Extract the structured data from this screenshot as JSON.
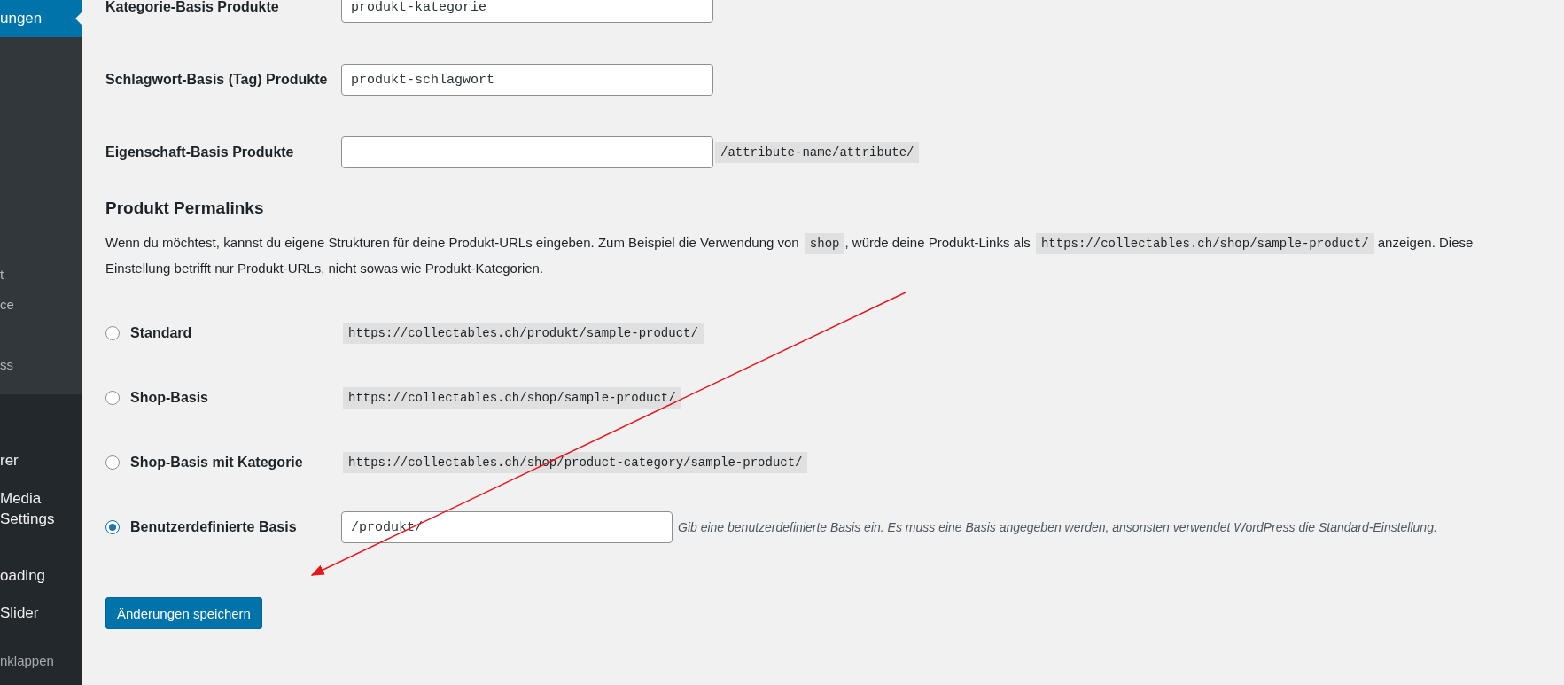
{
  "sidebar": {
    "items": [
      {
        "label": "ungen",
        "kind": "menu",
        "selected": true
      },
      {
        "label": "t",
        "kind": "submenu",
        "selected": false
      },
      {
        "label": "ce",
        "kind": "submenu",
        "selected": false
      },
      {
        "label": "ss",
        "kind": "submenu",
        "selected": false
      },
      {
        "label": "rer",
        "kind": "menu",
        "selected": false
      },
      {
        "label": "Media Settings",
        "kind": "menu",
        "selected": false
      },
      {
        "label": "oading",
        "kind": "menu",
        "selected": false
      },
      {
        "label": "Slider",
        "kind": "menu",
        "selected": false
      },
      {
        "label": "nklappen",
        "kind": "collapse",
        "selected": false
      }
    ]
  },
  "fields": [
    {
      "label": "Kategorie-Basis Produkte",
      "value": "produkt-kategorie"
    },
    {
      "label": "Schlagwort-Basis (Tag) Produkte",
      "value": "produkt-schlagwort"
    },
    {
      "label": "Eigenschaft-Basis Produkte",
      "example": "/attribute-name/attribute/"
    }
  ],
  "section_title": "Produkt Permalinks",
  "description": [
    {
      "kind": "text",
      "text": "Wenn du möchtest, kannst du eigene Strukturen für deine Produkt-URLs eingeben. Zum Beispiel die Verwendung von "
    },
    {
      "kind": "code",
      "text": "shop"
    },
    {
      "kind": "text",
      "text": ", würde deine Produkt-Links als "
    },
    {
      "kind": "code",
      "text": "https://collectables.ch/shop/sample-product/"
    },
    {
      "kind": "text",
      "text": " anzeigen. Diese Einstellung betrifft nur Produkt-URLs, nicht sowas wie Produkt-Kategorien."
    }
  ],
  "options": [
    {
      "label": "Standard",
      "kind": "example",
      "selected": false,
      "example": "https://collectables.ch/produkt/sample-product/"
    },
    {
      "label": "Shop-Basis",
      "kind": "example",
      "selected": false,
      "example": "https://collectables.ch/shop/sample-product/"
    },
    {
      "label": "Shop-Basis mit Kategorie",
      "kind": "example",
      "selected": false,
      "example": "https://collectables.ch/shop/product-category/sample-product/"
    },
    {
      "label": "Benutzerdefinierte Basis",
      "kind": "input",
      "selected": true,
      "value": "/produkt/",
      "hint": "Gib eine benutzerdefinierte Basis ein. Es muss eine Basis angegeben werden, ansonsten verwendet WordPress die Standard-Einstellung."
    }
  ],
  "save_button": "Änderungen speichern"
}
